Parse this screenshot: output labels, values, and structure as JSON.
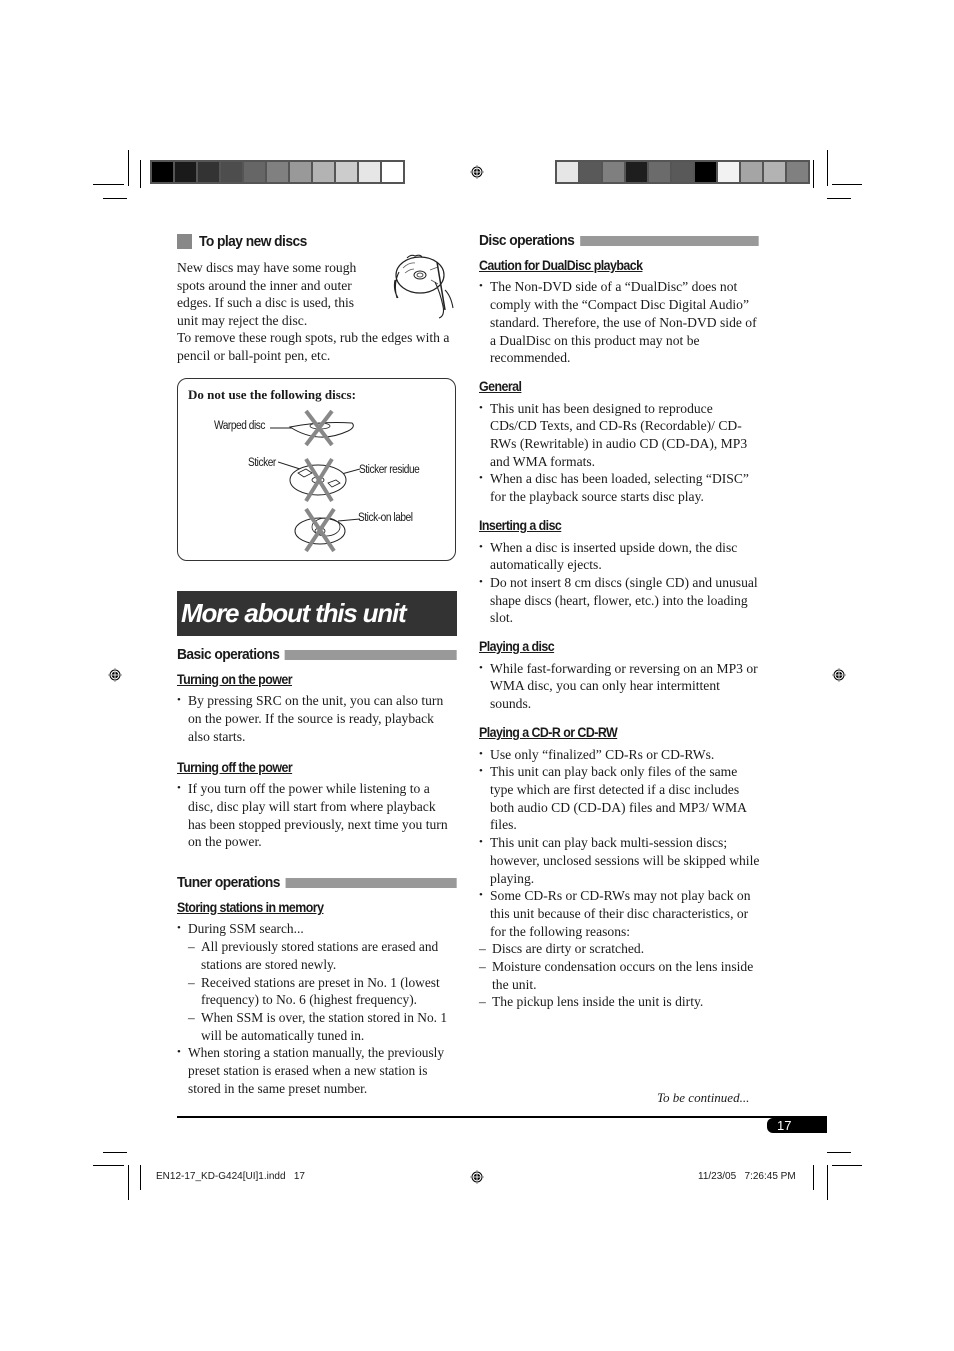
{
  "print_marks": {
    "color_bar_left": [
      "#000000",
      "#1a1a1a",
      "#333333",
      "#4d4d4d",
      "#666666",
      "#808080",
      "#999999",
      "#b3b3b3",
      "#cccccc",
      "#e6e6e6",
      "#ffffff"
    ],
    "color_bar_right": [
      "#e6e6e6",
      "#595959",
      "#7f7f7f",
      "#1e1e1e",
      "#6b6b6b",
      "#595959",
      "#000000",
      "#f2f2f2",
      "#a5a5a5",
      "#b3b3b3",
      "#808080"
    ]
  },
  "left": {
    "play_new_discs": {
      "heading": "To play new discs",
      "para1": "New discs may have some rough spots around the inner and outer edges. If such a disc is used, this unit may reject the disc.",
      "para2": "To remove these rough spots, rub the edges with a pencil or ball-point pen, etc."
    },
    "disc_box": {
      "title": "Do not use the following discs:",
      "labels": {
        "warped": "Warped disc",
        "sticker": "Sticker",
        "sticker_residue": "Sticker residue",
        "stick_on": "Stick-on label"
      }
    },
    "banner": "More about this unit",
    "basic_operations": {
      "heading": "Basic operations",
      "turning_on": {
        "heading": "Turning on the power",
        "bullets": [
          "By pressing SRC on the unit, you can also turn on the power. If the source is ready, playback also starts."
        ]
      },
      "turning_off": {
        "heading": "Turning off the power",
        "bullets": [
          "If you turn off the power while listening to a disc, disc play will start from where playback has been stopped previously, next time you turn on the power."
        ]
      }
    },
    "tuner_operations": {
      "heading": "Tuner operations",
      "storing": {
        "heading": "Storing stations in memory",
        "bullet1": "During SSM search...",
        "dashes": [
          "All previously stored stations are erased and stations are stored newly.",
          "Received stations are preset in No. 1 (lowest frequency) to No. 6 (highest frequency).",
          "When SSM is over, the station stored in No. 1 will be automatically tuned in."
        ],
        "bullet2": "When storing a station manually, the previously preset station is erased when a new station is stored in the same preset number."
      }
    }
  },
  "right": {
    "heading": "Disc operations",
    "dualdisc": {
      "heading": "Caution for DualDisc playback",
      "bullets": [
        "The Non-DVD side of a “DualDisc” does not comply with the “Compact Disc Digital Audio” standard. Therefore, the use of Non-DVD side of a DualDisc on this product may not be recommended."
      ]
    },
    "general": {
      "heading": "General",
      "bullets": [
        "This unit has been designed to reproduce CDs/CD Texts, and CD-Rs (Recordable)/ CD-RWs (Rewritable) in audio CD (CD-DA), MP3 and WMA formats.",
        "When a disc has been loaded, selecting “DISC” for the playback source starts disc play."
      ]
    },
    "inserting": {
      "heading": "Inserting a disc",
      "bullets": [
        "When a disc is inserted upside down, the disc automatically ejects.",
        "Do not insert 8 cm discs (single CD) and unusual shape discs (heart, flower, etc.) into the loading slot."
      ]
    },
    "playing": {
      "heading": "Playing a disc",
      "bullets": [
        "While fast-forwarding or reversing on an MP3 or WMA disc, you can only hear intermittent sounds."
      ]
    },
    "cdr": {
      "heading": "Playing a CD-R or CD-RW",
      "bullets": [
        "Use only “finalized” CD-Rs or CD-RWs.",
        "This unit can play back only files of the same type which are first detected if a disc includes both audio CD (CD-DA) files and MP3/ WMA files.",
        "This unit can play back multi-session discs; however, unclosed sessions will be skipped while playing."
      ],
      "last_bullet": "Some CD-Rs or CD-RWs may not play back on this unit because of their disc characteristics, or for the following reasons:",
      "dashes": [
        "Discs are dirty or scratched.",
        "Moisture condensation occurs on the lens inside the unit.",
        "The pickup lens inside the unit is dirty."
      ]
    },
    "continued": "To be continued..."
  },
  "footer": {
    "page_number": "17",
    "file_name": "EN12-17_KD-G424[UI]1.indd   17",
    "timestamp": "11/23/05   7:26:45 PM"
  }
}
